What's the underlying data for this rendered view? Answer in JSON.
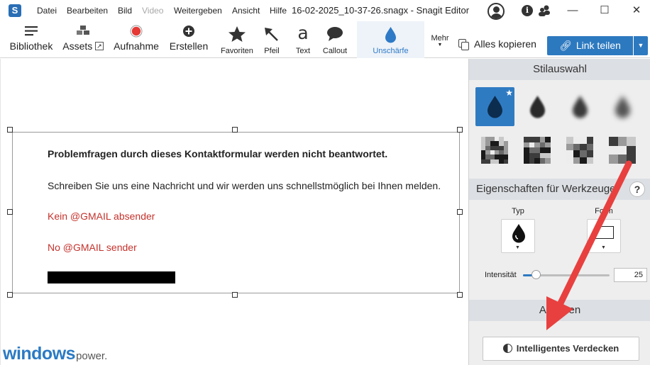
{
  "titlebar": {
    "app_icon": "S",
    "menus": [
      "Datei",
      "Bearbeiten",
      "Bild",
      "Video",
      "Weitergeben",
      "Ansicht",
      "Hilfe"
    ],
    "title": "16-02-2025_10-37-26.snagx - Snagit Editor",
    "window_controls": {
      "minimize": "—",
      "maximize": "☐",
      "close": "✕"
    },
    "icons": [
      "user-avatar-icon",
      "info-icon",
      "community-icon"
    ]
  },
  "toolbar": {
    "library": "Bibliothek",
    "assets": "Assets",
    "capture": "Aufnahme",
    "create": "Erstellen",
    "favorites": "Favoriten",
    "arrow": "Pfeil",
    "text": "Text",
    "callout": "Callout",
    "blur": "Unschärfe",
    "more": "Mehr",
    "copy_all": "Alles kopieren",
    "share_link": "Link teilen",
    "text_glyph": "a",
    "accent_color": "#2d79c0",
    "capture_color": "#e53935"
  },
  "canvas": {
    "line1": "Problemfragen durch dieses Kontaktformular werden nicht beantwortet.",
    "line2": "Schreiben Sie uns eine Nachricht und wir werden uns schnellstmöglich bei Ihnen melden.",
    "line3": "Kein @GMAIL absender",
    "line4": "No @GMAIL sender",
    "text_red_color": "#c4322c",
    "watermark_main": "windows",
    "watermark_sub": "power."
  },
  "panel": {
    "style_header": "Stilauswahl",
    "props_header": "Eigenschaften für Werkzeuge",
    "help": "?",
    "type_label": "Typ",
    "shape_label": "Form",
    "intensity_label": "Intensität",
    "intensity_value": "25",
    "intensity_fraction": 0.15,
    "actions_header": "Aktionen",
    "smart_redact": "Intelligentes Verdecken",
    "selected_swatch_color": "#2f7bc2"
  },
  "annotation": {
    "arrow_color": "#e8403f"
  }
}
